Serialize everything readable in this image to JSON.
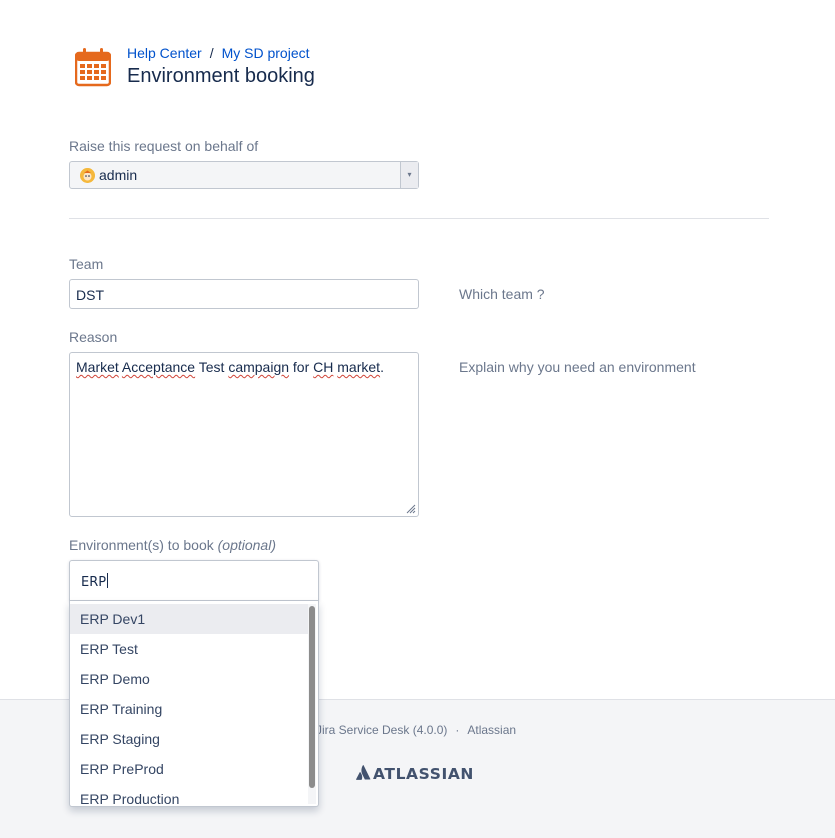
{
  "colors": {
    "brand_orange": "#e5691d",
    "link": "#0052cc",
    "text": "#172b4d",
    "muted": "#6b778c"
  },
  "header": {
    "icon": "calendar-icon",
    "breadcrumb": {
      "home": "Help Center",
      "separator": "/",
      "project": "My SD project"
    },
    "title": "Environment booking"
  },
  "behalf": {
    "label": "Raise this request on behalf of",
    "value": "admin",
    "caret": "▾"
  },
  "team": {
    "label": "Team",
    "value": "DST",
    "help": "Which team ?"
  },
  "reason": {
    "label": "Reason",
    "words": [
      "Market",
      "Acceptance",
      "Test",
      "campaign",
      "for",
      "CH",
      "market"
    ],
    "end": ".",
    "help": "Explain why you need an environment"
  },
  "environments": {
    "label": "Environment(s) to book",
    "optional": "(optional)",
    "query": "ERP",
    "options": [
      "ERP Dev1",
      "ERP Test",
      "ERP Demo",
      "ERP Training",
      "ERP Staging",
      "ERP PreProd",
      "ERP Production"
    ]
  },
  "footer": {
    "powered": "Jira Service Desk (4.0.0)",
    "separator": "·",
    "atlassian_link": "Atlassian",
    "logo_text": "ATLASSIAN"
  }
}
